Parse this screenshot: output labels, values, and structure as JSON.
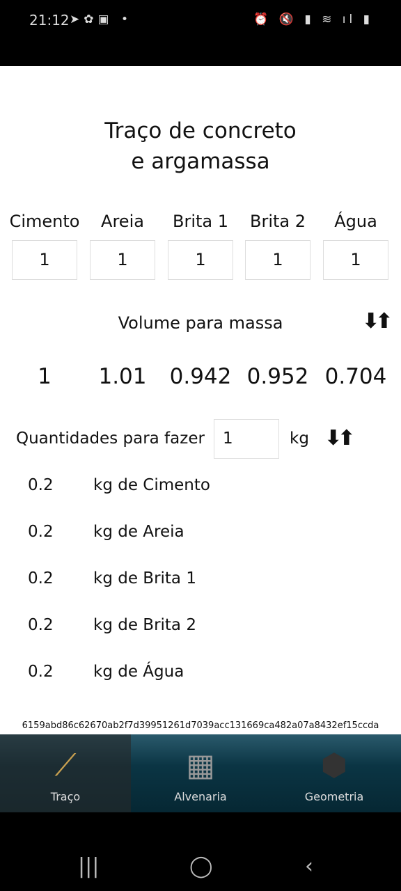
{
  "status": {
    "time": "21:12"
  },
  "title_line1": "Traço de concreto",
  "title_line2": "e argamassa",
  "materials": [
    {
      "label": "Cimento",
      "value": "1",
      "result": "1"
    },
    {
      "label": "Areia",
      "value": "1",
      "result": "1.01"
    },
    {
      "label": "Brita 1",
      "value": "1",
      "result": "0.942"
    },
    {
      "label": "Brita 2",
      "value": "1",
      "result": "0.952"
    },
    {
      "label": "Água",
      "value": "1",
      "result": "0.704"
    }
  ],
  "conversion_label": "Volume para massa",
  "quantity": {
    "label": "Quantidades para fazer",
    "value": "1",
    "unit": "kg"
  },
  "amounts": [
    {
      "value": "0.2",
      "label": "kg de Cimento"
    },
    {
      "value": "0.2",
      "label": "kg de Areia"
    },
    {
      "value": "0.2",
      "label": "kg de Brita 1"
    },
    {
      "value": "0.2",
      "label": "kg de Brita 2"
    },
    {
      "value": "0.2",
      "label": "kg de Água"
    }
  ],
  "hash": "6159abd86c62670ab2f7d39951261d7039acc131669ca482a07a8432ef15ccda",
  "nav": [
    {
      "label": "Traço",
      "icon": "trowel-icon",
      "active": true
    },
    {
      "label": "Alvenaria",
      "icon": "brick-icon"
    },
    {
      "label": "Geometria",
      "icon": "cube-icon"
    }
  ]
}
